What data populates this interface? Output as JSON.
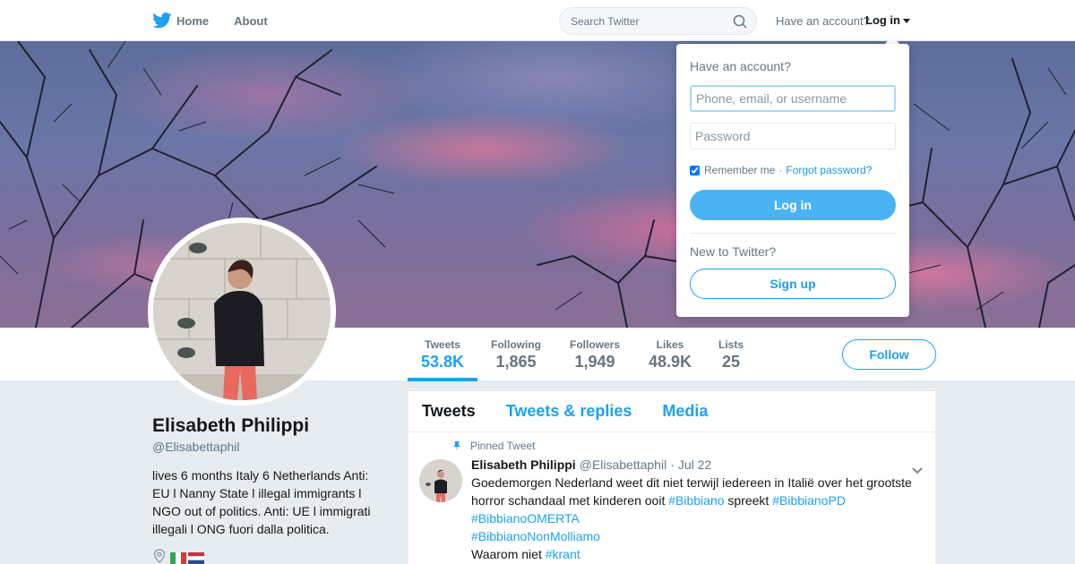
{
  "nav": {
    "home_label": "Home",
    "about_label": "About",
    "search_placeholder": "Search Twitter",
    "have_account": "Have an account?",
    "login_label": "Log in"
  },
  "profile": {
    "name": "Elisabeth Philippi",
    "handle": "@Elisabettaphil",
    "bio": "lives 6 months Italy 6 Netherlands Anti: EU l Nanny State l illegal immigrants l NGO out of politics. Anti: UE l immigrati illegali l ONG fuori dalla politica."
  },
  "stats": [
    {
      "label": "Tweets",
      "value": "53.8K"
    },
    {
      "label": "Following",
      "value": "1,865"
    },
    {
      "label": "Followers",
      "value": "1,949"
    },
    {
      "label": "Likes",
      "value": "48.9K"
    },
    {
      "label": "Lists",
      "value": "25"
    }
  ],
  "follow_label": "Follow",
  "timeline": {
    "tabs": [
      "Tweets",
      "Tweets & replies",
      "Media"
    ],
    "tweet": {
      "pinned_label": "Pinned Tweet",
      "name": "Elisabeth Philippi",
      "handle": "@Elisabettaphil",
      "time": "Jul 22",
      "text_line1": "Goedemorgen Nederland weet dit niet terwijl iedereen in Italië  over het grootste",
      "text_line2_prefix": "horror schandaal met kinderen ooit ",
      "hashtag1": "#Bibbiano",
      "text_mid": " spreekt ",
      "hashtag2": "#BibbianoPD",
      "hashtag3": "#BibbianoOMERTA",
      "hashtag4": "#BibbianoNonMolliamo",
      "text_last_prefix": "Waarom niet  ",
      "hashtag5": "#krant"
    }
  },
  "login_dropdown": {
    "title": "Have an account?",
    "username_placeholder": "Phone, email, or username",
    "password_placeholder": "Password",
    "remember_label": "Remember me",
    "separator": "·",
    "forgot_label": "Forgot password?",
    "login_button": "Log in",
    "new_label": "New to Twitter?",
    "signup_button": "Sign up"
  },
  "colors": {
    "accent": "#1da1f2",
    "login_button": "#4ab3f4",
    "background": "#e6ecf0"
  },
  "icons": [
    "twitter-bird-icon",
    "search-icon",
    "caret-down-icon",
    "pin-icon",
    "chevron-down-icon",
    "location-icon",
    "italy-flag-icon",
    "netherlands-flag-icon"
  ]
}
